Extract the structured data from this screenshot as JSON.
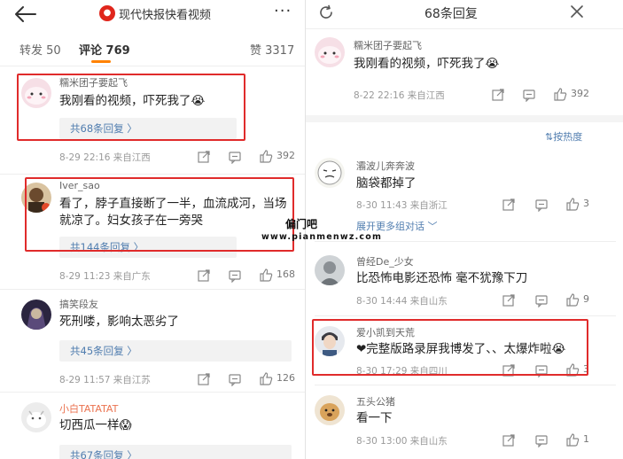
{
  "left": {
    "post_title": "现代快报快看视频",
    "tabs": {
      "forward": "转发 50",
      "comments": "评论 769",
      "likes": "赞 3317"
    },
    "comments": [
      {
        "user": "糯米团子要起飞",
        "text_lines": [
          "我刚看的视频，吓死我了😭"
        ],
        "replies": "共68条回复 〉",
        "meta": "8-29 22:16  来自江西",
        "likes": "392",
        "highlighted": true
      },
      {
        "user": "Iver_sao",
        "text_lines": [
          "看了，脖子直接断了一半，血流成河，当场",
          "就凉了。妇女孩子在一旁哭"
        ],
        "replies": "共144条回复 〉",
        "meta": "8-29 11:23  来自广东",
        "likes": "168",
        "highlighted": true
      },
      {
        "user": "搞笑段友",
        "text_lines": [
          "死刑喽，影响太恶劣了"
        ],
        "replies": "共45条回复 〉",
        "meta": "8-29 11:57  来自江苏",
        "likes": "126",
        "highlighted": false
      },
      {
        "user": "小白TATATAT",
        "text_lines": [
          "切西瓜一样😱"
        ],
        "replies": "共67条回复 〉",
        "meta": "",
        "likes": "",
        "highlighted": false
      }
    ]
  },
  "right": {
    "title": "68条回复",
    "root": {
      "user": "糯米团子要起飞",
      "text": "我刚看的视频，吓死我了😭",
      "meta": "8-22 22:16  来自江西",
      "likes": "392"
    },
    "sort_label": "⇅按热度",
    "replies": [
      {
        "user": "灞波儿奔奔波",
        "text": "脑袋都掉了",
        "meta": "8-30 11:43  来自浙江",
        "likes": "3",
        "expand": "展开更多组对话 ﹀"
      },
      {
        "user": "曾经De_少女",
        "text": "比恐怖电影还恐怖  毫不犹豫下刀",
        "meta": "8-30 14:44  来自山东",
        "likes": "9",
        "expand": ""
      },
      {
        "user": "爱小凯到天荒",
        "text": "❤完整版路录屏我博发了、、太爆炸啦😭",
        "meta": "8-30 17:29  来自四川",
        "likes": "3",
        "expand": "",
        "highlighted": true
      },
      {
        "user": "五头公猪",
        "text": "看一下",
        "meta": "8-30 13:00  来自山东",
        "likes": "1",
        "expand": ""
      }
    ]
  },
  "watermark": {
    "title": "偏门吧",
    "url": "www.pianmenwz.com"
  },
  "colors": {
    "accent_orange": "#ff8200",
    "link_blue": "#507daf",
    "highlight_red": "#e02b2b"
  }
}
